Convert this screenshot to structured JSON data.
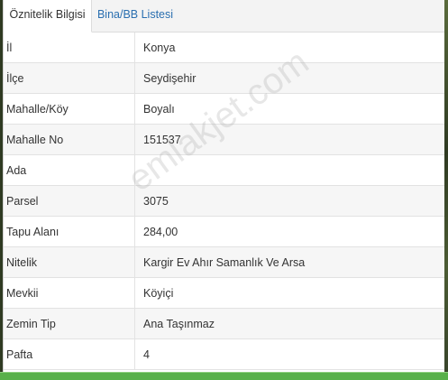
{
  "tabs": [
    {
      "label": "Öznitelik Bilgisi",
      "active": true
    },
    {
      "label": "Bina/BB Listesi",
      "active": false
    }
  ],
  "rows": [
    {
      "key": "İl",
      "value": "Konya"
    },
    {
      "key": "İlçe",
      "value": "Seydişehir"
    },
    {
      "key": "Mahalle/Köy",
      "value": "Boyalı"
    },
    {
      "key": "Mahalle No",
      "value": "151537"
    },
    {
      "key": "Ada",
      "value": ""
    },
    {
      "key": "Parsel",
      "value": "3075"
    },
    {
      "key": "Tapu Alanı",
      "value": "284,00"
    },
    {
      "key": "Nitelik",
      "value": "Kargir Ev Ahır Samanlık Ve Arsa"
    },
    {
      "key": "Mevkii",
      "value": "Köyiçi"
    },
    {
      "key": "Zemin Tip",
      "value": "Ana Taşınmaz"
    },
    {
      "key": "Pafta",
      "value": "4"
    }
  ],
  "watermark": "emlakjet.com",
  "colors": {
    "link": "#2a6fb0",
    "accent_bar": "#58b04a"
  }
}
